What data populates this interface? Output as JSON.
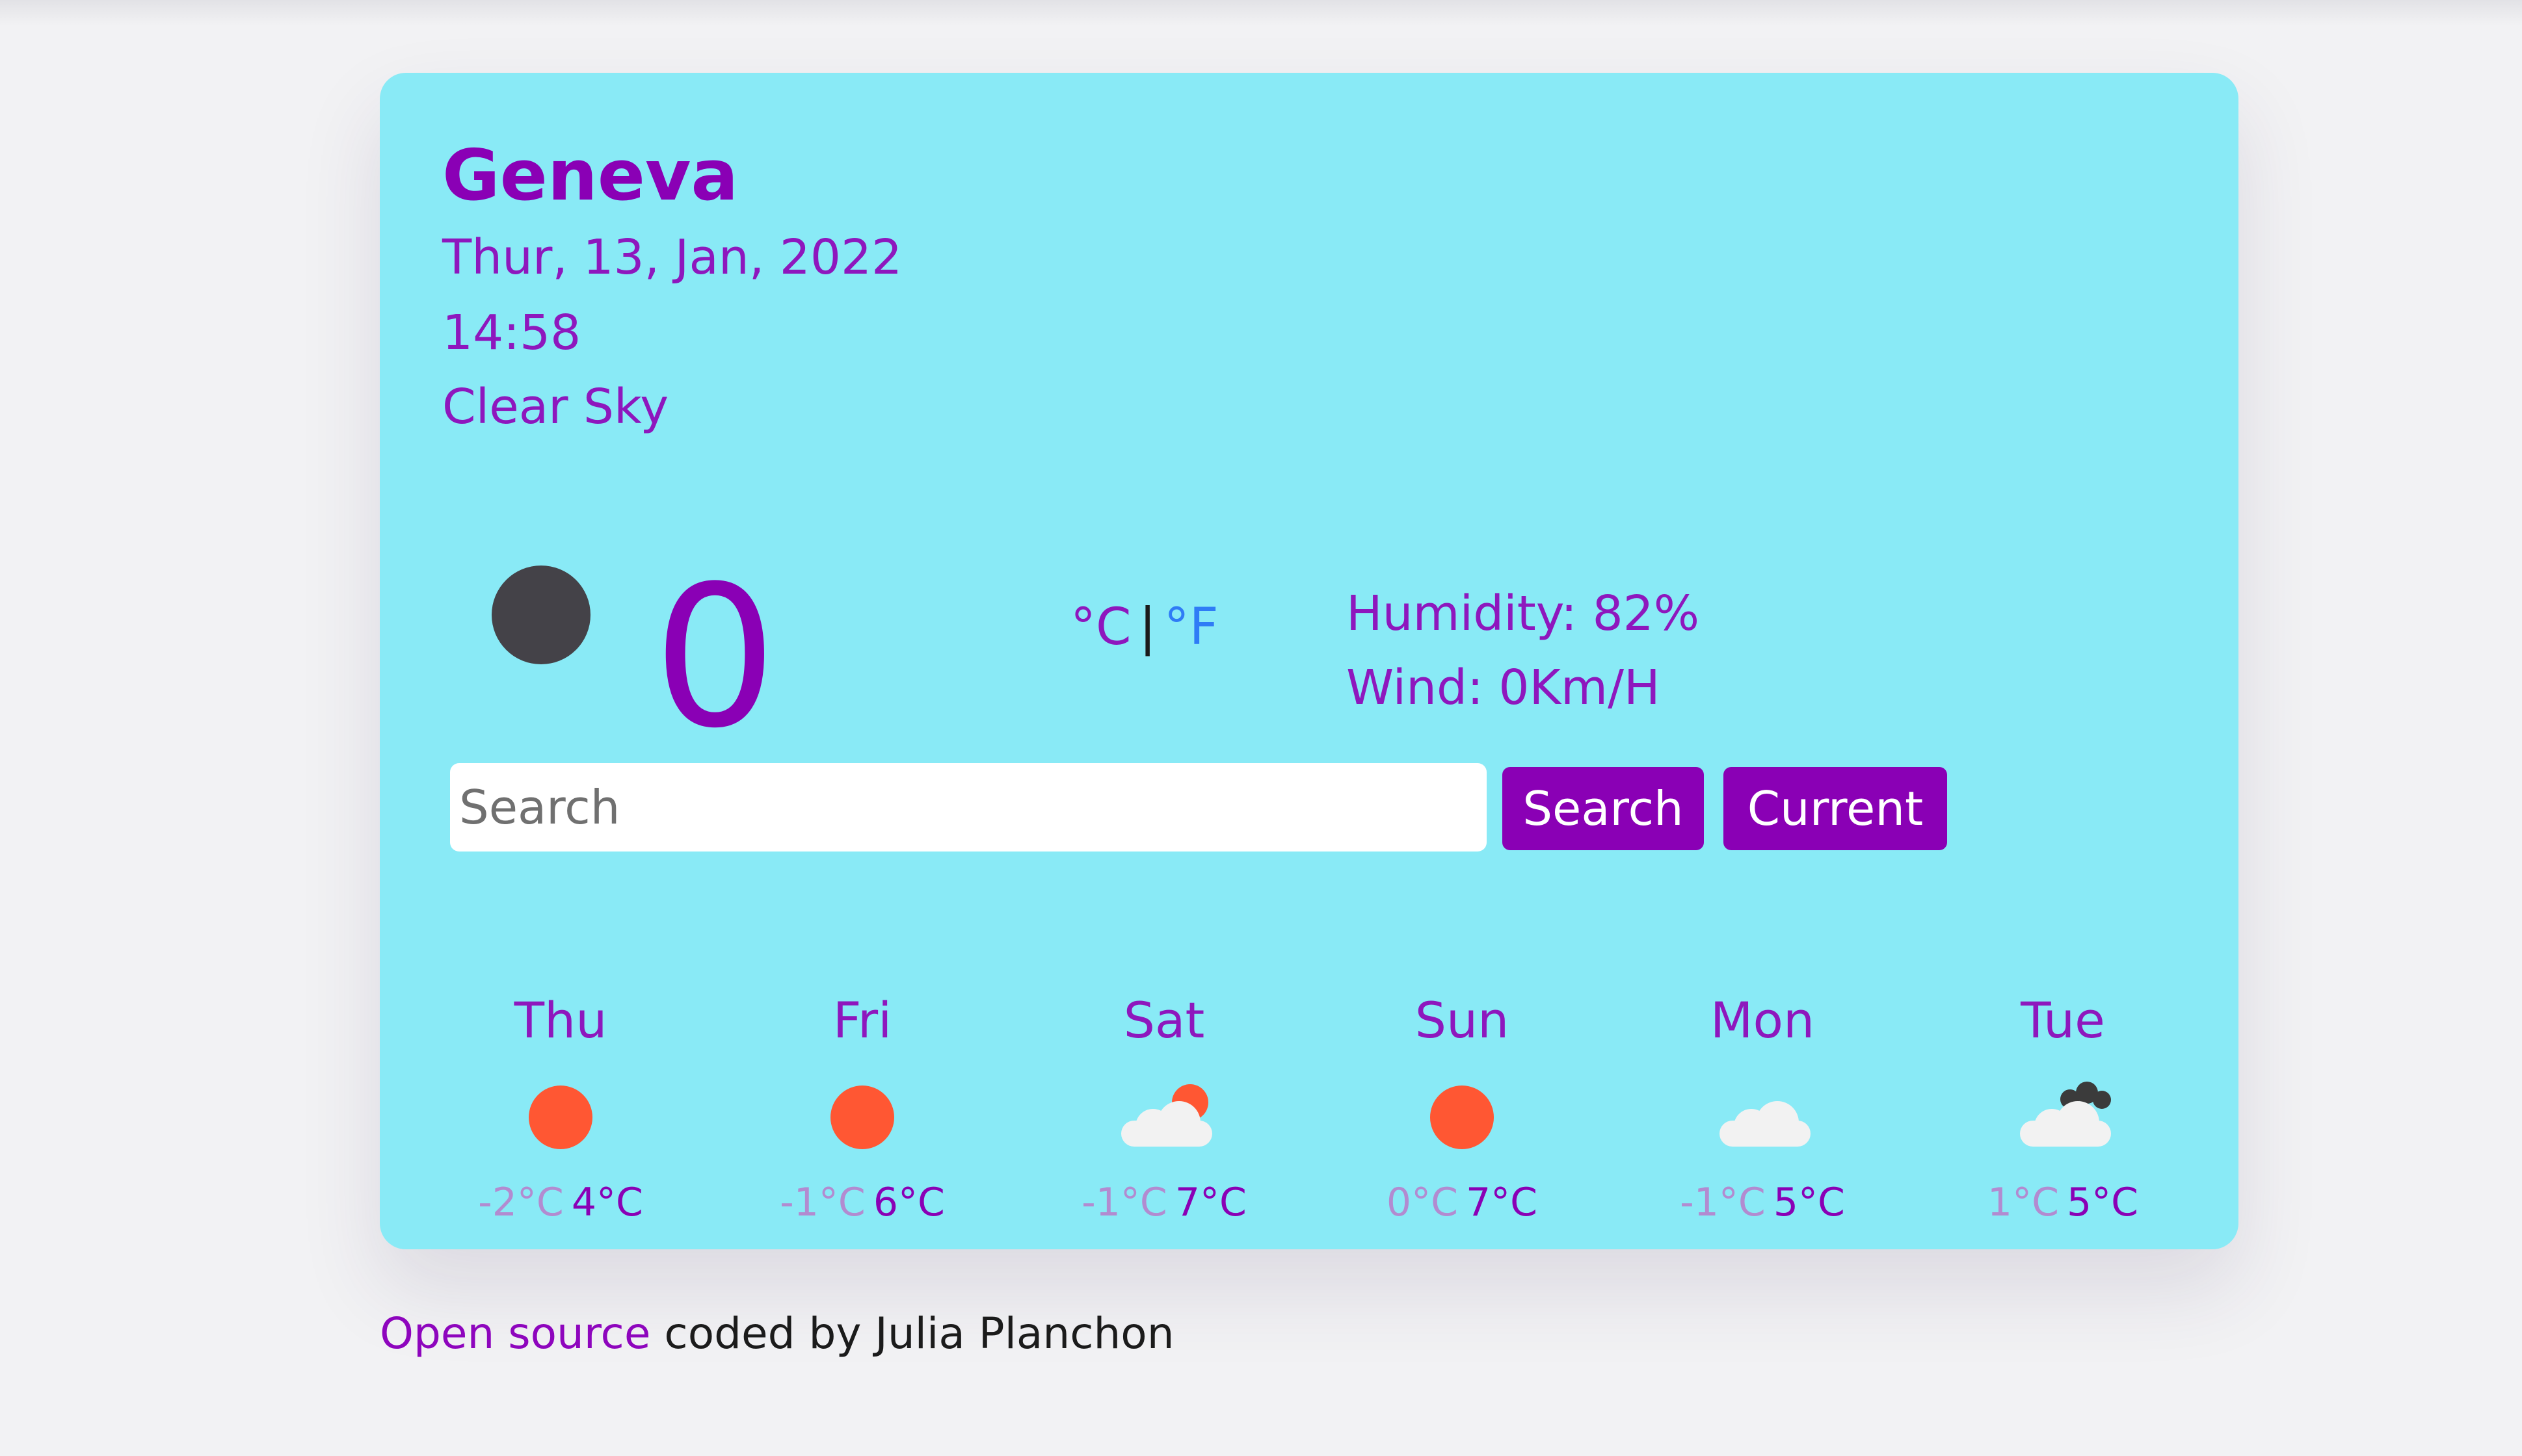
{
  "weather": {
    "city": "Geneva",
    "date": "Thur, 13, Jan, 2022",
    "time": "14:58",
    "description": "Clear Sky",
    "current_icon": "dark-circle-icon",
    "temperature": "0",
    "unit_celsius": "°C",
    "unit_separator": "|",
    "unit_fahrenheit": "°F",
    "humidity": "Humidity: 82%",
    "wind": "Wind: 0Km/H"
  },
  "search": {
    "placeholder": "Search",
    "value": "",
    "search_label": "Search",
    "current_label": "Current"
  },
  "forecast": [
    {
      "day": "Thu",
      "icon": "sun-icon",
      "min": "-2°C",
      "max": "4°C"
    },
    {
      "day": "Fri",
      "icon": "sun-icon",
      "min": "-1°C",
      "max": "6°C"
    },
    {
      "day": "Sat",
      "icon": "cloud-sun-icon",
      "min": "-1°C",
      "max": "7°C"
    },
    {
      "day": "Sun",
      "icon": "sun-icon",
      "min": "0°C",
      "max": "7°C"
    },
    {
      "day": "Mon",
      "icon": "cloud-icon",
      "min": "-1°C",
      "max": "5°C"
    },
    {
      "day": "Tue",
      "icon": "dark-cloud-icon",
      "min": "1°C",
      "max": "5°C"
    }
  ],
  "footer": {
    "link_text": "Open source",
    "text": " coded by Julia Planchon"
  },
  "colors": {
    "card_background": "#89eaf6",
    "accent_purple": "#8a00b5",
    "fahrenheit_blue": "#2f7cf6",
    "sun_orange": "#ff5733"
  }
}
